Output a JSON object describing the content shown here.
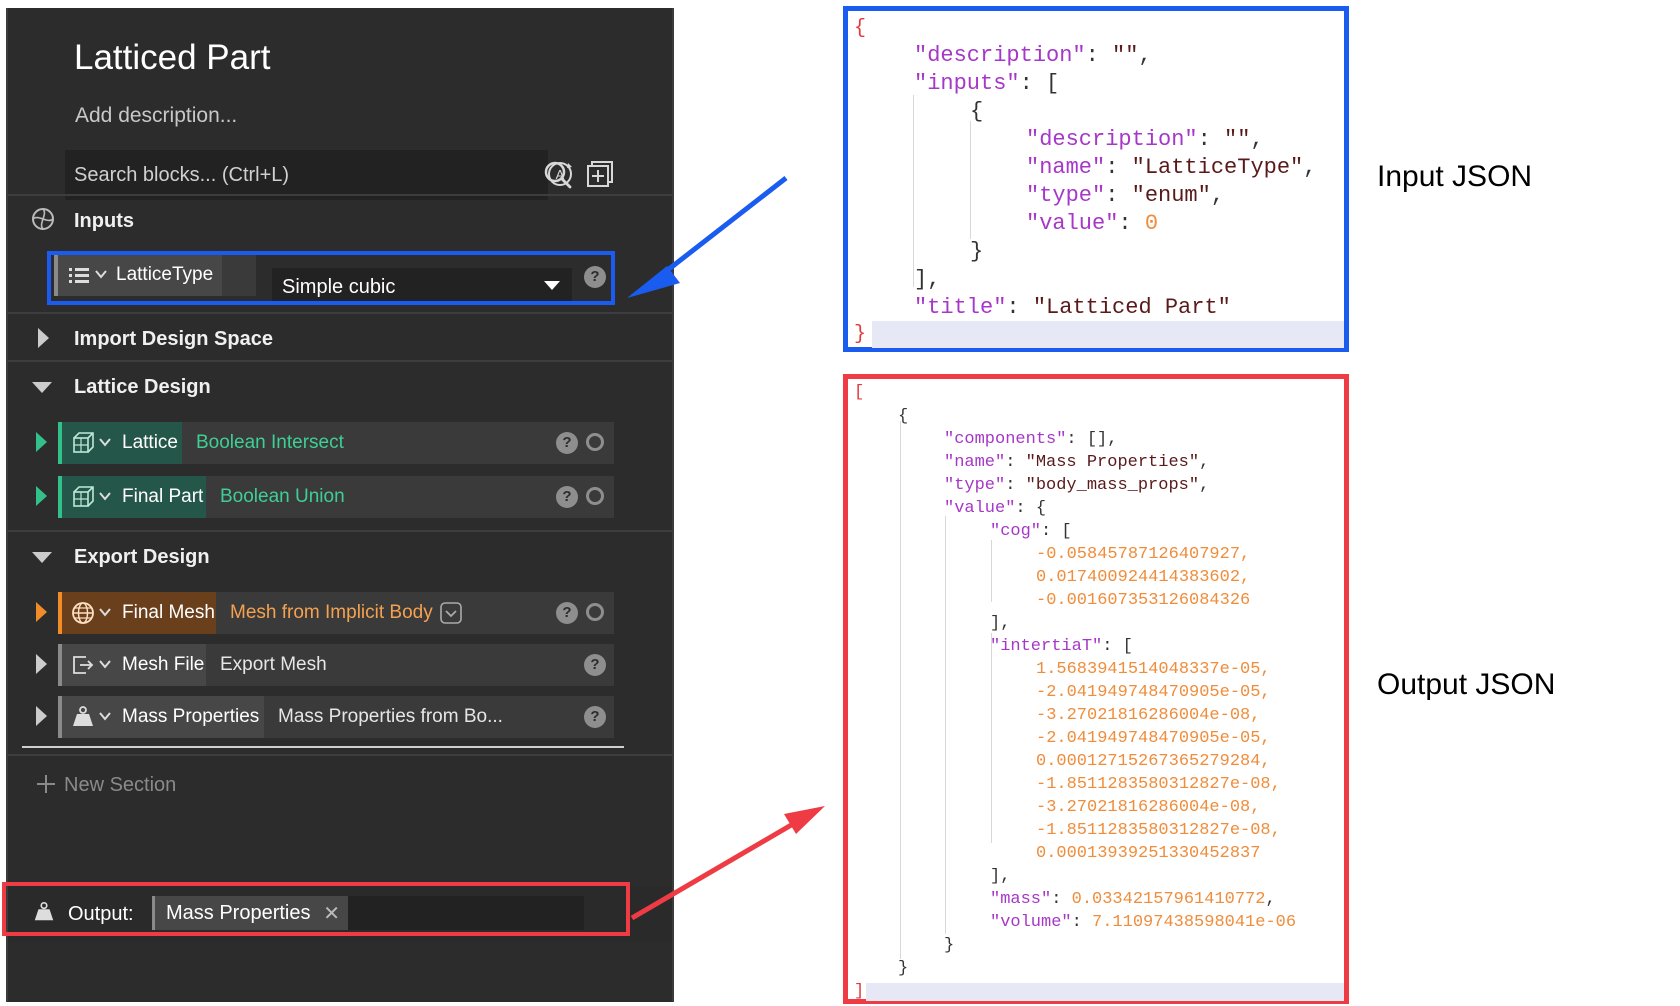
{
  "app": {
    "title": "Latticed Part",
    "description_placeholder": "Add description...",
    "search_placeholder": "Search blocks... (Ctrl+L)"
  },
  "inputs_section": {
    "label": "Inputs",
    "row": {
      "tag": "LatticeType",
      "value": "Simple cubic"
    }
  },
  "sections": {
    "import": {
      "label": "Import Design Space"
    },
    "lattice": {
      "label": "Lattice Design",
      "rows": [
        {
          "tag": "Lattice",
          "op": "Boolean Intersect"
        },
        {
          "tag": "Final Part",
          "op": "Boolean Union"
        }
      ]
    },
    "export": {
      "label": "Export Design",
      "rows": [
        {
          "tag": "Final Mesh",
          "op": "Mesh from Implicit Body"
        },
        {
          "tag": "Mesh File",
          "op": "Export Mesh"
        },
        {
          "tag": "Mass Properties",
          "op": "Mass Properties from Bo..."
        }
      ]
    }
  },
  "help_glyph": "?",
  "new_section": "New Section",
  "output": {
    "label": "Output:",
    "chip": "Mass Properties",
    "clear_glyph": "✕"
  },
  "captions": {
    "input": "Input JSON",
    "output": "Output JSON"
  },
  "colors": {
    "input_highlight": "#1a5cf0",
    "output_highlight": "#ee3b44",
    "green_tag": "#34c08a",
    "orange_tag": "#f28c28"
  },
  "input_json": {
    "open": "{",
    "close": "}",
    "lines": {
      "l1": {
        "k": "\"description\"",
        "p": ": ",
        "v": "\"\"",
        "e": ","
      },
      "l2": {
        "k": "\"inputs\"",
        "p": ": ["
      },
      "l3": "{",
      "l4": {
        "k": "\"description\"",
        "p": ": ",
        "v": "\"\"",
        "e": ","
      },
      "l5": {
        "k": "\"name\"",
        "p": ": ",
        "v": "\"LatticeType\"",
        "e": ","
      },
      "l6": {
        "k": "\"type\"",
        "p": ": ",
        "v": "\"enum\"",
        "e": ","
      },
      "l7": {
        "k": "\"value\"",
        "p": ": ",
        "v": "0"
      },
      "l8": "}",
      "l9": "],",
      "l10": {
        "k": "\"title\"",
        "p": ": ",
        "v": "\"Latticed Part\""
      }
    }
  },
  "output_json": {
    "open": "[",
    "close": "]",
    "obj_open": "{",
    "obj_close": "}",
    "components": {
      "k": "\"components\"",
      "p": ": [],"
    },
    "name": {
      "k": "\"name\"",
      "p": ": ",
      "v": "\"Mass Properties\"",
      "e": ","
    },
    "type": {
      "k": "\"type\"",
      "p": ": ",
      "v": "\"body_mass_props\"",
      "e": ","
    },
    "value": {
      "k": "\"value\"",
      "p": ": {"
    },
    "cog": {
      "k": "\"cog\"",
      "p": ": [",
      "close": "],"
    },
    "cog_values": [
      "-0.05845787126407927,",
      "0.017400924414383602,",
      "-0.001607353126084326"
    ],
    "inertia": {
      "k": "\"intertiaT\"",
      "p": ": [",
      "close": "],"
    },
    "inertia_values": [
      "1.5683941514048337e-05,",
      "-2.041949748470905e-05,",
      "-3.27021816286004e-08,",
      "-2.041949748470905e-05,",
      "0.00012715267365279284,",
      "-1.8511283580312827e-08,",
      "-3.27021816286004e-08,",
      "-1.8511283580312827e-08,",
      "0.00013939251330452837"
    ],
    "mass": {
      "k": "\"mass\"",
      "p": ": ",
      "v": "0.03342157961410772",
      "e": ","
    },
    "volume": {
      "k": "\"volume\"",
      "p": ": ",
      "v": "7.11097438598041e-06"
    },
    "value_close": "}"
  }
}
